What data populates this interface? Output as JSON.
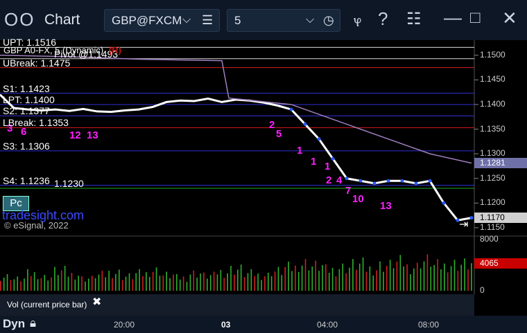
{
  "window": {
    "title": "Chart",
    "symbol": "GBP@FXCM",
    "interval": "5"
  },
  "price_chart": {
    "header": "GBP A0-FX, 5 (Dynamic)",
    "header_tag": "(R)",
    "watermark_site": "tradesight.com",
    "watermark_copyright": "© eSignal, 2022",
    "levels": [
      {
        "label": "UPT: 1.1516",
        "value": 1.1516,
        "color": "#ffffff"
      },
      {
        "label": "Pivot @1.1493",
        "value": 1.1493,
        "color": "#ffffff"
      },
      {
        "label": "UBreak: 1.1475",
        "value": 1.1475,
        "color": "#ff2020"
      },
      {
        "label": "S1: 1.1423",
        "value": 1.1423,
        "color": "#3a3aff"
      },
      {
        "label": "LPT: 1.1400",
        "value": 1.14,
        "color": "#3a3aff"
      },
      {
        "label": "S2: 1.1377",
        "value": 1.1377,
        "color": "#3a3aff"
      },
      {
        "label": "LBreak: 1.1353",
        "value": 1.1353,
        "color": "#ff2020"
      },
      {
        "label": "S3: 1.1306",
        "value": 1.1306,
        "color": "#3a3aff"
      },
      {
        "label": "S4: 1.1236",
        "value": 1.1236,
        "color": "#3a3aff"
      },
      {
        "label": "1.1230",
        "value": 1.123,
        "color": "#20c020"
      }
    ],
    "y_ticks": [
      "1.1500",
      "1.1450",
      "1.1400",
      "1.1350",
      "1.1300",
      "1.1250",
      "1.1200",
      "1.1150"
    ],
    "y_range": [
      1.114,
      1.1525
    ],
    "price_tags": [
      {
        "label": "1.1281",
        "value": 1.1281,
        "bg": "#7070a8",
        "fg": "#ffffff"
      },
      {
        "label": "1.1170",
        "value": 1.117,
        "bg": "#d0d0d0",
        "fg": "#000000"
      }
    ],
    "seq_labels": [
      "3",
      "6",
      "12",
      "13",
      "2",
      "5",
      "1",
      "1",
      "1",
      "2",
      "4",
      "7",
      "10",
      "13"
    ],
    "button_label": "Pc"
  },
  "volume_pane": {
    "label": "Vol (current price bar)",
    "y_ticks": [
      "8000",
      "0"
    ],
    "current_tag": "4065",
    "current_value": 4065,
    "y_max": 8000
  },
  "x_axis": {
    "ticks": [
      "20:00",
      "03",
      "04:00",
      "08:00"
    ]
  },
  "status": {
    "mode": "Dyn"
  },
  "chart_data": {
    "type": "line",
    "title": "GBP A0-FX, 5 (Dynamic)",
    "series": [
      {
        "name": "Price",
        "color": "#ffffff",
        "x": [
          0,
          20,
          40,
          60,
          80,
          100,
          120,
          140,
          160,
          180,
          200,
          220,
          240,
          260,
          280,
          300,
          320,
          340,
          360,
          380,
          400,
          420,
          440,
          460,
          480,
          500,
          520,
          540,
          560,
          580,
          600,
          620,
          640,
          660,
          680
        ],
        "values": [
          1.142,
          1.1393,
          1.139,
          1.1388,
          1.139,
          1.1387,
          1.1391,
          1.1386,
          1.1385,
          1.1388,
          1.139,
          1.1395,
          1.1405,
          1.1408,
          1.1407,
          1.1412,
          1.1405,
          1.141,
          1.1408,
          1.1404,
          1.1398,
          1.139,
          1.136,
          1.133,
          1.129,
          1.125,
          1.1245,
          1.124,
          1.1245,
          1.1245,
          1.124,
          1.1245,
          1.12,
          1.1165,
          1.117
        ]
      },
      {
        "name": "MA",
        "color": "#a080c0",
        "x": [
          0,
          100,
          200,
          320,
          330,
          420,
          480,
          560,
          620,
          680
        ],
        "values": [
          1.15,
          1.1497,
          1.1492,
          1.1489,
          1.1413,
          1.14,
          1.137,
          1.133,
          1.13,
          1.1281
        ]
      }
    ],
    "volume_values": [
      2200,
      1800,
      2600,
      2100,
      3000,
      2500,
      1900,
      2400,
      2800,
      2200,
      2600,
      3100,
      2400,
      2000,
      2700,
      2300,
      2900,
      3300,
      2600,
      2400,
      3000,
      3500,
      4200,
      3800,
      3200,
      3600,
      4000,
      3400,
      3900,
      4300,
      3700,
      4600,
      3800,
      4100,
      4065
    ]
  }
}
